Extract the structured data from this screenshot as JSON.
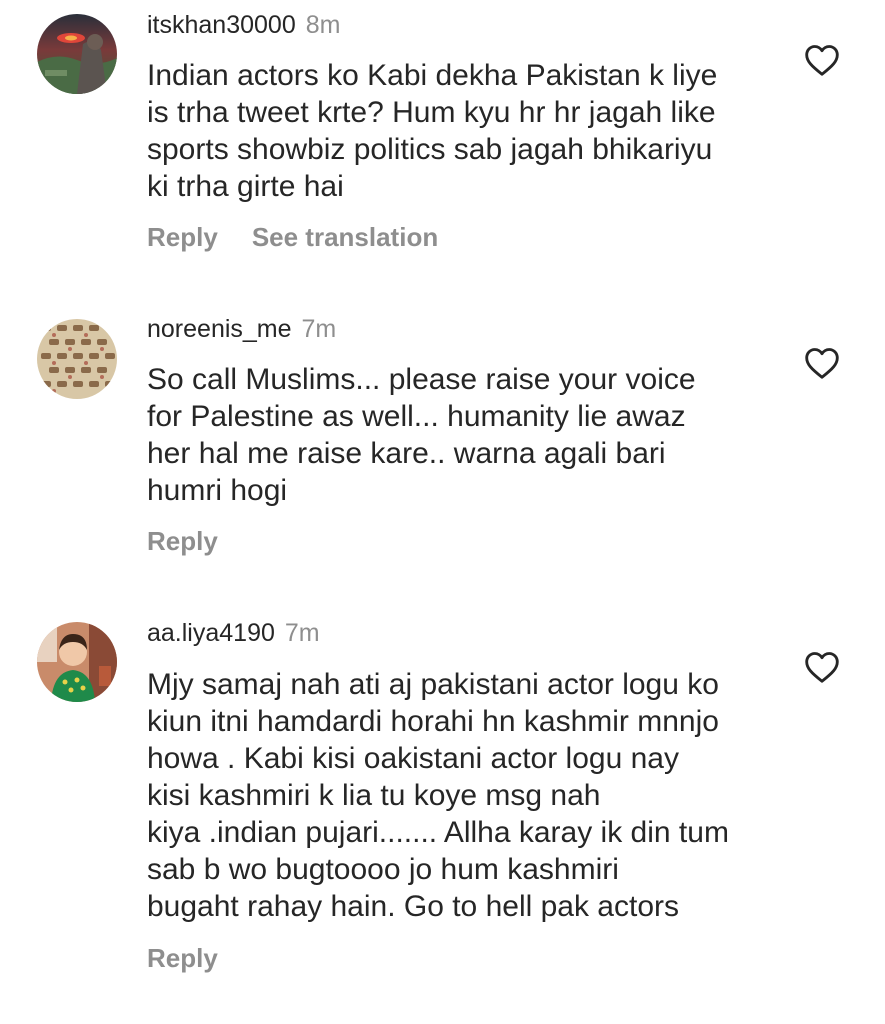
{
  "comments": [
    {
      "username": "itskhan30000",
      "time": "8m",
      "text": "Indian actors ko Kabi dekha Pakistan k liye\nis trha tweet krte? Hum kyu hr hr jagah like\nsports showbiz politics sab jagah bhikariyu\nki trha girte hai",
      "reply_label": "Reply",
      "translation_label": "See translation",
      "icon": "heart-outline-icon"
    },
    {
      "username": "noreenis_me",
      "time": "7m",
      "text": "So call Muslims... please raise your voice\nfor Palestine as well... humanity lie awaz\nher hal me raise kare.. warna agali bari\nhumri hogi",
      "reply_label": "Reply",
      "icon": "heart-outline-icon"
    },
    {
      "username": "aa.liya4190",
      "time": "7m",
      "text": "Mjy samaj nah ati aj pakistani actor logu ko\nkiun itni hamdardi horahi hn kashmir mnnjo\nhowa . Kabi kisi oakistani actor logu nay\nkisi kashmiri  k lia tu koye msg nah\nkiya .indian pujari....... Allha karay ik din tum\nsab b wo bugtoooo jo hum kashmiri\nbugaht rahay hain. Go to  hell pak actors",
      "reply_label": "Reply",
      "icon": "heart-outline-icon"
    }
  ],
  "colors": {
    "text_primary": "#262626",
    "text_secondary": "#8e8e8e",
    "background": "#ffffff"
  }
}
